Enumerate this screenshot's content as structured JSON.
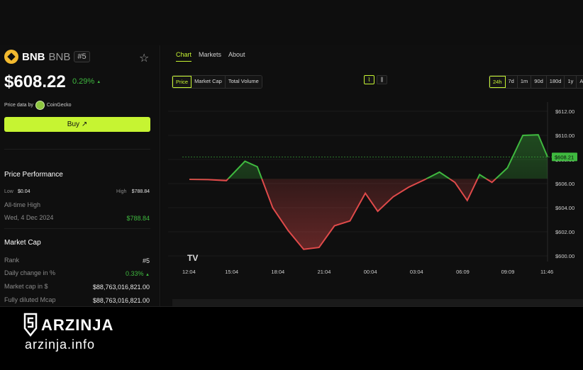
{
  "coin": {
    "name": "BNB",
    "symbol": "BNB",
    "rank": "#5",
    "price": "$608.22",
    "change": "0.29%",
    "price_data_by": "Price data by",
    "provider": "CoinGecko",
    "buy_label": "Buy"
  },
  "performance": {
    "title": "Price Performance",
    "low_label": "Low",
    "low_value": "$0.04",
    "high_label": "High",
    "high_value": "$788.84",
    "ath_label": "All-time High",
    "ath_date": "Wed, 4 Dec 2024",
    "ath_value": "$788.84"
  },
  "market_cap": {
    "title": "Market Cap",
    "rows": [
      {
        "label": "Rank",
        "value": "#5"
      },
      {
        "label": "Daily change in %",
        "value": "0.33%"
      },
      {
        "label": "Market cap in $",
        "value": "$88,763,016,821.00"
      },
      {
        "label": "Fully diluted Mcap",
        "value": "$88,763,016,821.00"
      }
    ]
  },
  "tabs": [
    "Chart",
    "Markets",
    "About"
  ],
  "metric_options": [
    "Price",
    "Market Cap",
    "Total Volume"
  ],
  "range_options": [
    "24h",
    "7d",
    "1m",
    "90d",
    "180d",
    "1y",
    "All"
  ],
  "chart_watermark": "TV",
  "banner": {
    "brand": "ARZINJA",
    "url": "arzinja.info"
  },
  "colors": {
    "accent": "#c6f432",
    "up": "#3fb93f",
    "down": "#e04a4a",
    "brand_bnb": "#f3ba2f"
  },
  "chart_data": {
    "type": "line",
    "title": "",
    "x_ticks": [
      "12:04",
      "15:04",
      "18:04",
      "21:04",
      "00:04",
      "03:04",
      "06:09",
      "09:09",
      "11:46"
    ],
    "y_ticks": [
      "$612.00",
      "$610.00",
      "$608.00",
      "$606.00",
      "$604.00",
      "$602.00",
      "$600.00"
    ],
    "ylim": [
      600,
      612
    ],
    "baseline": 606.4,
    "current_label": "$608.21",
    "current_value": 608.21,
    "points": [
      [
        0.0,
        606.35
      ],
      [
        0.6,
        606.33
      ],
      [
        1.2,
        606.25
      ],
      [
        1.8,
        607.85
      ],
      [
        2.2,
        607.4
      ],
      [
        2.7,
        604.0
      ],
      [
        3.2,
        602.1
      ],
      [
        3.7,
        600.55
      ],
      [
        4.2,
        600.7
      ],
      [
        4.7,
        602.5
      ],
      [
        5.2,
        602.9
      ],
      [
        5.7,
        605.2
      ],
      [
        6.1,
        603.7
      ],
      [
        6.6,
        604.9
      ],
      [
        7.1,
        605.7
      ],
      [
        7.6,
        606.3
      ],
      [
        8.1,
        606.95
      ],
      [
        8.6,
        606.1
      ],
      [
        9.0,
        604.6
      ],
      [
        9.4,
        606.75
      ],
      [
        9.8,
        606.1
      ],
      [
        10.3,
        607.3
      ],
      [
        10.8,
        610.0
      ],
      [
        11.3,
        610.05
      ],
      [
        11.6,
        608.21
      ]
    ]
  }
}
